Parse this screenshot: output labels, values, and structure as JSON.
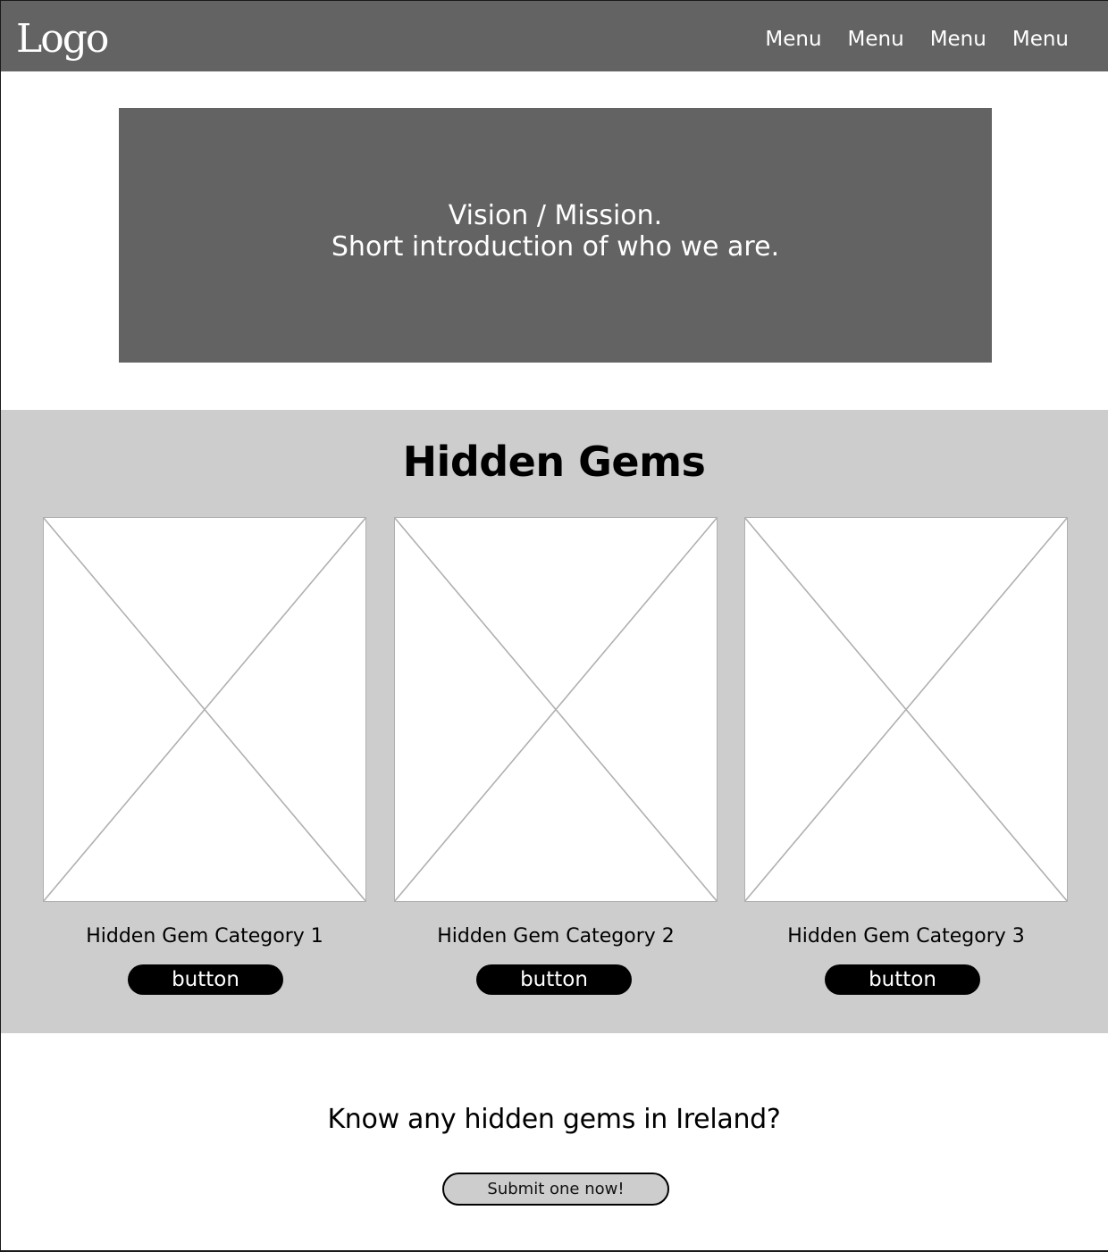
{
  "header": {
    "logo": "Logo",
    "menu": [
      "Menu",
      "Menu",
      "Menu",
      "Menu"
    ]
  },
  "hero": {
    "line1": "Vision / Mission.",
    "line2": "Short introduction of who we are."
  },
  "gems": {
    "title": "Hidden Gems",
    "cards": [
      {
        "caption": "Hidden Gem Category 1",
        "button": "button",
        "image": "image-placeholder"
      },
      {
        "caption": "Hidden Gem Category 2",
        "button": "button",
        "image": "image-placeholder"
      },
      {
        "caption": "Hidden Gem Category 3",
        "button": "button",
        "image": "image-placeholder"
      }
    ]
  },
  "cta": {
    "question": "Know any hidden gems in Ireland?",
    "button": "Submit one now!"
  },
  "colors": {
    "header_bg": "#636363",
    "hero_bg": "#636363",
    "section_bg": "#cdcdcd",
    "button_bg": "#000000",
    "placeholder_line": "#b0b0b0"
  }
}
